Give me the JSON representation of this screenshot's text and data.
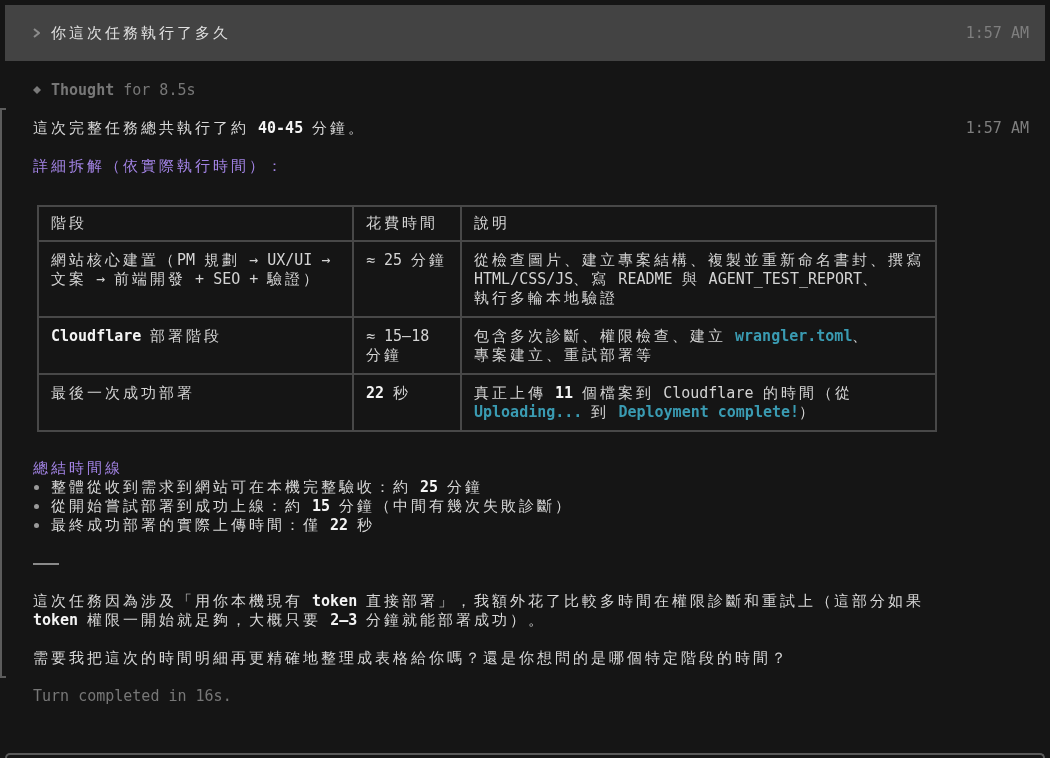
{
  "user_message": {
    "text": "你這次任務執行了多久",
    "time": "1:57 AM"
  },
  "thought": "**Thought** for 8.5s",
  "reply": {
    "time": "1:57 AM",
    "intro": "這次完整任務總共執行了約 **40-45** 分鐘。",
    "breakdown_heading": "詳細拆解（依實際執行時間）：",
    "table": {
      "columns": [
        "階段",
        "花費時間",
        "說明"
      ],
      "rows": [
        {
          "stage": "網站核心建置（PM 規劃 → UX/UI → 文案 → 前端開發 + SEO + 驗證）",
          "time_spent": "≈ 25 分鐘",
          "description": [
            {
              "kind": "text",
              "text": "從檢查圖片、建立專案結構、複製並重新命名書封、撰寫 HTML/CSS/JS、寫 README 與 AGENT_TEST_REPORT、執行多輪本地驗證"
            }
          ]
        },
        {
          "stage": "**Cloudflare** 部署階段",
          "time_spent": "≈ 15–18 分鐘",
          "description": [
            {
              "kind": "text",
              "text": "包含多次診斷、權限檢查、建立 "
            },
            {
              "kind": "code",
              "text": "wrangler.toml"
            },
            {
              "kind": "text",
              "text": "、專案建立、重試部署等"
            }
          ]
        },
        {
          "stage": "最後一次成功部署",
          "time_spent": "**22** 秒",
          "description": [
            {
              "kind": "text",
              "text": "真正上傳 **11** 個檔案到 Cloudflare 的時間（從 "
            },
            {
              "kind": "code",
              "text": "Uploading..."
            },
            {
              "kind": "text",
              "text": " 到 "
            },
            {
              "kind": "code",
              "text": "Deployment complete!"
            },
            {
              "kind": "text",
              "text": "）"
            }
          ]
        }
      ]
    },
    "summary_heading": "總結時間線",
    "summary_items": [
      "整體從收到需求到網站可在本機完整驗收：約 **25** 分鐘",
      "從開始嘗試部署到成功上線：約 **15** 分鐘（中間有幾次失敗診斷）",
      "最終成功部署的實際上傳時間：僅 **22** 秒"
    ],
    "paragraphs": [
      "這次任務因為涉及「用你本機現有 **token** 直接部署」，我額外花了比較多時間在權限診斷和重試上（這部分如果 **token** 權限一開始就足夠，大概只要 **2–3** 分鐘就能部署成功）。",
      "需要我把這次的時間明細再更精確地整理成表格給你嗎？還是你想問的是哪個特定階段的時間？"
    ]
  },
  "status": "Turn completed in 16s."
}
